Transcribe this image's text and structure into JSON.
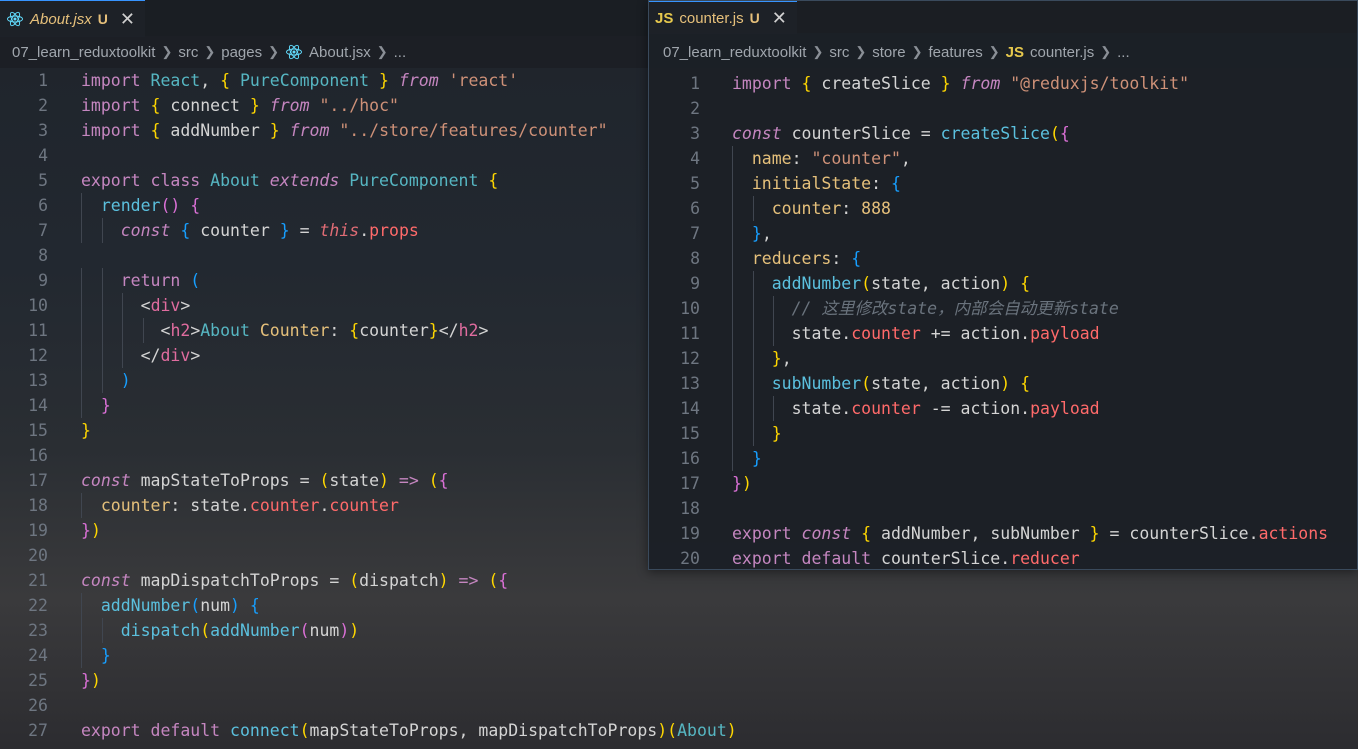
{
  "left_editor": {
    "tab": {
      "filename": "About.jsx",
      "status": "U"
    },
    "breadcrumb": [
      "07_learn_reduxtoolkit",
      "src",
      "pages",
      "About.jsx",
      "..."
    ],
    "lines": [
      {
        "n": "1",
        "t": "import React, { PureComponent } from 'react'"
      },
      {
        "n": "2",
        "t": "import { connect } from \"../hoc\""
      },
      {
        "n": "3",
        "t": "import { addNumber } from \"../store/features/counter\""
      },
      {
        "n": "4",
        "t": ""
      },
      {
        "n": "5",
        "t": "export class About extends PureComponent {"
      },
      {
        "n": "6",
        "t": "  render() {"
      },
      {
        "n": "7",
        "t": "    const { counter } = this.props"
      },
      {
        "n": "8",
        "t": ""
      },
      {
        "n": "9",
        "t": "    return ("
      },
      {
        "n": "10",
        "t": "      <div>"
      },
      {
        "n": "11",
        "t": "        <h2>About Counter: {counter}</h2>"
      },
      {
        "n": "12",
        "t": "      </div>"
      },
      {
        "n": "13",
        "t": "    )"
      },
      {
        "n": "14",
        "t": "  }"
      },
      {
        "n": "15",
        "t": "}"
      },
      {
        "n": "16",
        "t": ""
      },
      {
        "n": "17",
        "t": "const mapStateToProps = (state) => ({"
      },
      {
        "n": "18",
        "t": "  counter: state.counter.counter"
      },
      {
        "n": "19",
        "t": "})"
      },
      {
        "n": "20",
        "t": ""
      },
      {
        "n": "21",
        "t": "const mapDispatchToProps = (dispatch) => ({"
      },
      {
        "n": "22",
        "t": "  addNumber(num) {"
      },
      {
        "n": "23",
        "t": "    dispatch(addNumber(num))"
      },
      {
        "n": "24",
        "t": "  }"
      },
      {
        "n": "25",
        "t": "})"
      },
      {
        "n": "26",
        "t": ""
      },
      {
        "n": "27",
        "t": "export default connect(mapStateToProps, mapDispatchToProps)(About)"
      }
    ]
  },
  "right_editor": {
    "tab": {
      "filename": "counter.js",
      "status": "U",
      "lang_badge": "JS"
    },
    "breadcrumb": [
      "07_learn_reduxtoolkit",
      "src",
      "store",
      "features",
      "counter.js",
      "..."
    ],
    "lines": [
      {
        "n": "1",
        "t": "import { createSlice } from \"@reduxjs/toolkit\""
      },
      {
        "n": "2",
        "t": ""
      },
      {
        "n": "3",
        "t": "const counterSlice = createSlice({"
      },
      {
        "n": "4",
        "t": "  name: \"counter\","
      },
      {
        "n": "5",
        "t": "  initialState: {"
      },
      {
        "n": "6",
        "t": "    counter: 888"
      },
      {
        "n": "7",
        "t": "  },"
      },
      {
        "n": "8",
        "t": "  reducers: {"
      },
      {
        "n": "9",
        "t": "    addNumber(state, action) {"
      },
      {
        "n": "10",
        "t": "      // 这里修改state，内部会自动更新state"
      },
      {
        "n": "11",
        "t": "      state.counter += action.payload"
      },
      {
        "n": "12",
        "t": "    },"
      },
      {
        "n": "13",
        "t": "    subNumber(state, action) {"
      },
      {
        "n": "14",
        "t": "      state.counter -= action.payload"
      },
      {
        "n": "15",
        "t": "    }"
      },
      {
        "n": "16",
        "t": "  }"
      },
      {
        "n": "17",
        "t": "})"
      },
      {
        "n": "18",
        "t": ""
      },
      {
        "n": "19",
        "t": "export const { addNumber, subNumber } = counterSlice.actions"
      },
      {
        "n": "20",
        "t": "export default counterSlice.reducer"
      }
    ]
  },
  "icons": {
    "react_file": "react-icon",
    "close": "close-icon",
    "js_file": "js-icon"
  },
  "colors": {
    "accent": "#3794ff",
    "modified": "#e6c07b",
    "background": "#1f242b"
  }
}
